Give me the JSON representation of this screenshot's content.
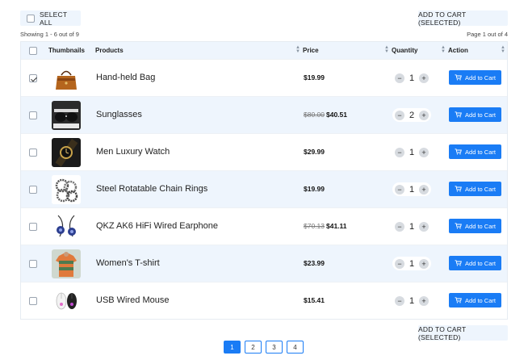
{
  "toolbar": {
    "select_all_label": "SELECT ALL",
    "add_selected_label": "ADD TO CART (SELECTED)"
  },
  "info": {
    "showing": "Showing 1 - 6 out of 9",
    "page": "Page 1 out of 4"
  },
  "table": {
    "headers": {
      "thumbnails": "Thumbnails",
      "products": "Products",
      "price": "Price",
      "quantity": "Quantity",
      "action": "Action"
    },
    "add_label": "Add to Cart",
    "rows": [
      {
        "name": "Hand-held Bag",
        "old_price": "",
        "price": "$19.99",
        "qty": "1",
        "checked": true,
        "icon": "handbag-icon"
      },
      {
        "name": "Sunglasses",
        "old_price": "$80.00",
        "price": "$40.51",
        "qty": "2",
        "checked": false,
        "icon": "sunglasses-icon"
      },
      {
        "name": "Men Luxury Watch",
        "old_price": "",
        "price": "$29.99",
        "qty": "1",
        "checked": false,
        "icon": "watch-icon"
      },
      {
        "name": "Steel Rotatable Chain Rings",
        "old_price": "",
        "price": "$19.99",
        "qty": "1",
        "checked": false,
        "icon": "rings-icon"
      },
      {
        "name": "QKZ AK6 HiFi Wired Earphone",
        "old_price": "$70.13",
        "price": "$41.11",
        "qty": "1",
        "checked": false,
        "icon": "earphone-icon"
      },
      {
        "name": "Women's T-shirt",
        "old_price": "",
        "price": "$23.99",
        "qty": "1",
        "checked": false,
        "icon": "tshirt-icon"
      },
      {
        "name": "USB Wired Mouse",
        "old_price": "",
        "price": "$15.41",
        "qty": "1",
        "checked": false,
        "icon": "mouse-icon"
      }
    ]
  },
  "pagination": {
    "pages": [
      "1",
      "2",
      "3",
      "4"
    ],
    "active": "1"
  },
  "colors": {
    "accent": "#1a7cf5",
    "row_alt": "#eef5fd"
  }
}
